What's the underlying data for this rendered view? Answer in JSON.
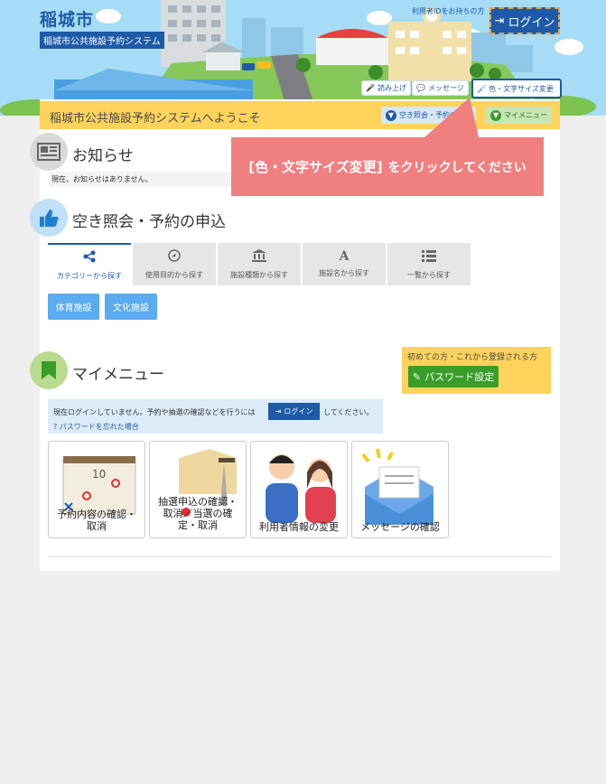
{
  "header": {
    "city_name": "稲城市",
    "system_name": "稲城市公共施設予約システム",
    "user_note": "利用者IDをお持ちの方",
    "login_label": "ログイン",
    "util_buttons": {
      "read_aloud": "読み上げ",
      "message": "メッセージ",
      "color_font": "色・文字サイズ変更"
    }
  },
  "welcome": {
    "text": "稲城市公共施設予約システムへようこそ",
    "availability_btn": "空き照会・予約の申込",
    "mymenu_btn": "マイメニュー"
  },
  "callout": {
    "bracket_text": "[色・文字サイズ変更]",
    "rest_text": "をクリックしてください"
  },
  "notice": {
    "title": "お知らせ",
    "body": "現在、お知らせはありません。"
  },
  "availability": {
    "title": "空き照会・予約の申込",
    "tabs": [
      {
        "label": "カテゴリーから探す",
        "icon": "share-icon",
        "glyph": "⋖"
      },
      {
        "label": "使用目的から探す",
        "icon": "compass-icon",
        "glyph": "◎"
      },
      {
        "label": "施設種類から探す",
        "icon": "institution-icon",
        "glyph": "🏛"
      },
      {
        "label": "施設名から探す",
        "icon": "font-icon",
        "glyph": "A"
      },
      {
        "label": "一覧から探す",
        "icon": "list-icon",
        "glyph": "☰"
      }
    ],
    "categories": [
      "体育施設",
      "文化施設"
    ]
  },
  "mymenu": {
    "title": "マイメニュー",
    "first_time_text": "初めての方・これから登録される方",
    "password_btn": "パスワード設定",
    "login_info_before": "現在ログインしていません。予約や抽選の確認などを行うには",
    "login_btn": "ログイン",
    "login_info_after": "してください。",
    "forgot_password": "パスワードを忘れた場合",
    "cards": [
      {
        "label_lines": [
          "予約内容の確認・",
          "取消"
        ]
      },
      {
        "label_lines": [
          "抽選申込の確認・",
          "取消／当選の確",
          "定・取消"
        ]
      },
      {
        "label_lines": [
          "利用者情報の変更"
        ]
      },
      {
        "label_lines": [
          "メッセージの確認"
        ]
      }
    ]
  },
  "colors": {
    "brand_blue": "#1d5aa7",
    "welcome_yellow": "#fdd35c",
    "callout_red": "#f07f7f",
    "accent_green": "#3a9d2a"
  }
}
